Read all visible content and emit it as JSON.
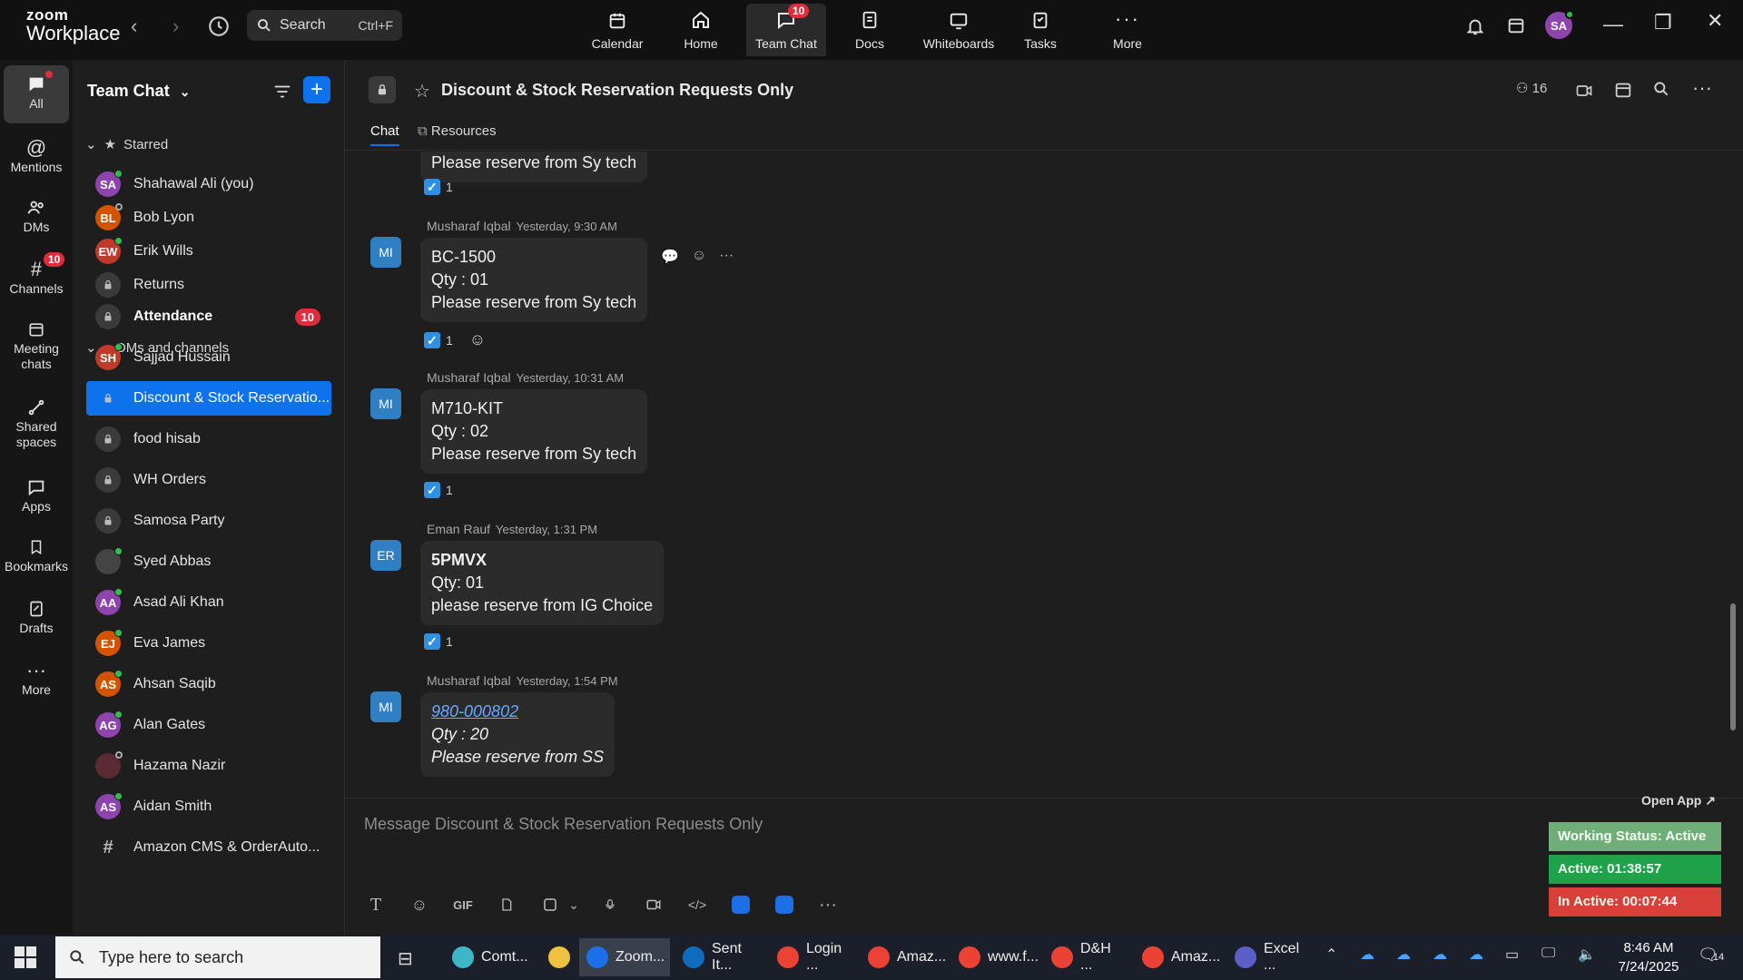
{
  "app": {
    "logo_line1": "zoom",
    "logo_line2": "Workplace",
    "search_label": "Search",
    "search_shortcut": "Ctrl+F"
  },
  "topnav": [
    {
      "label": "Calendar",
      "icon": "calendar-icon"
    },
    {
      "label": "Home",
      "icon": "home-icon"
    },
    {
      "label": "Team Chat",
      "icon": "chat-icon",
      "badge": "10",
      "active": true
    },
    {
      "label": "Docs",
      "icon": "docs-icon"
    },
    {
      "label": "Whiteboards",
      "icon": "whiteboard-icon"
    },
    {
      "label": "Tasks",
      "icon": "tasks-icon"
    },
    {
      "label": "More",
      "icon": "more-icon"
    }
  ],
  "user_initials": "SA",
  "rail": [
    {
      "label": "All",
      "icon": "chat-bubble-icon"
    },
    {
      "label": "Mentions",
      "icon": "at-icon"
    },
    {
      "label": "DMs",
      "icon": "people-icon"
    },
    {
      "label": "Channels",
      "icon": "hash-icon",
      "badge": "10"
    },
    {
      "label": "Meeting",
      "label2": "chats",
      "icon": "calendar-icon"
    },
    {
      "label": "Shared",
      "label2": "spaces",
      "icon": "share-icon"
    },
    {
      "label": "Apps",
      "icon": "apps-icon"
    },
    {
      "label": "Bookmarks",
      "icon": "bookmark-icon"
    },
    {
      "label": "Drafts",
      "icon": "drafts-icon"
    },
    {
      "label": "More",
      "icon": "more-icon"
    }
  ],
  "sidebar": {
    "title": "Team Chat",
    "starred_label": "Starred",
    "dms_label": "DMs and channels",
    "starred": [
      {
        "name": "Shahawal Ali (you)",
        "initials": "SA",
        "color": "#8e44ad",
        "status": "online"
      },
      {
        "name": "Bob Lyon",
        "initials": "BL",
        "color": "#d35400",
        "status": "away"
      },
      {
        "name": "Erik Wills",
        "initials": "EW",
        "color": "#c0392b",
        "status": "online"
      },
      {
        "name": "Returns",
        "type": "channel"
      }
    ],
    "items": [
      {
        "name": "Attendance",
        "type": "channel",
        "bold": true,
        "badge": "10"
      },
      {
        "name": "Sajjad Hussain",
        "initials": "SH",
        "color": "#c0392b",
        "status": "online"
      },
      {
        "name": "Discount & Stock Reservatio...",
        "type": "channel",
        "selected": true
      },
      {
        "name": "food hisab",
        "type": "channel"
      },
      {
        "name": "WH Orders",
        "type": "channel"
      },
      {
        "name": "Samosa Party",
        "type": "channel"
      },
      {
        "name": "Syed Abbas",
        "initials": "",
        "color": "#444444",
        "status": "online"
      },
      {
        "name": "Asad Ali Khan",
        "initials": "AA",
        "color": "#8e44ad",
        "status": "online"
      },
      {
        "name": "Eva James",
        "initials": "EJ",
        "color": "#d35400",
        "status": "online"
      },
      {
        "name": "Ahsan Saqib",
        "initials": "AS",
        "color": "#d35400",
        "status": "online"
      },
      {
        "name": "Alan Gates",
        "initials": "AG",
        "color": "#8e44ad",
        "status": "online"
      },
      {
        "name": "Hazama Nazir",
        "initials": "",
        "color": "#5a2a35",
        "status": "away"
      },
      {
        "name": "Aidan Smith",
        "initials": "AS",
        "color": "#8e44ad",
        "status": "online"
      },
      {
        "name": "Amazon CMS & OrderAuto...",
        "type": "hash"
      }
    ]
  },
  "channel": {
    "title": "Discount & Stock Reservation Requests Only",
    "members": "16",
    "tabs": [
      "Chat",
      "Resources"
    ]
  },
  "messages": {
    "partial_line": "Please reserve from Sy tech",
    "partial_reaction": "1",
    "list": [
      {
        "author": "Musharaf Iqbal",
        "time": "Yesterday, 9:30 AM",
        "initials": "MI",
        "lines": [
          "BC-1500",
          "Qty : 01",
          "Please reserve from Sy tech"
        ],
        "reaction": "1"
      },
      {
        "author": "Musharaf Iqbal",
        "time": "Yesterday, 10:31 AM",
        "initials": "MI",
        "lines": [
          "M710-KIT",
          "Qty : 02",
          "Please reserve from Sy tech"
        ],
        "reaction": "1"
      },
      {
        "author": "Eman Rauf",
        "time": "Yesterday, 1:31 PM",
        "initials": "ER",
        "lines": [
          "5PMVX",
          "Qty: 01",
          "please reserve from IG Choice"
        ],
        "reaction": "1"
      },
      {
        "author": "Musharaf Iqbal",
        "time": "Yesterday, 1:54 PM",
        "initials": "MI",
        "lines": [
          "980-000802",
          "Qty : 20",
          "Please reserve from SS"
        ]
      }
    ]
  },
  "composer": {
    "placeholder": "Message Discount & Stock Reservation Requests Only",
    "gif_label": "GIF"
  },
  "work_status": {
    "open_app": "Open App ↗",
    "status": "Working Status: Active",
    "active": "Active: 01:38:57",
    "inactive": "In Active: 00:07:44"
  },
  "taskbar": {
    "search_placeholder": "Type here to search",
    "apps": [
      {
        "label": "Comt...",
        "color": "#3fb6c8"
      },
      {
        "label": "",
        "color": "#f0c040"
      },
      {
        "label": "Zoom...",
        "color": "#1d6fe8"
      },
      {
        "label": "Sent It...",
        "color": "#0f6cbd"
      },
      {
        "label": "Login ...",
        "color": "#ea4335"
      },
      {
        "label": "Amaz...",
        "color": "#ea4335"
      },
      {
        "label": "www.f...",
        "color": "#ea4335"
      },
      {
        "label": "D&H ...",
        "color": "#ea4335"
      },
      {
        "label": "Amaz...",
        "color": "#ea4335"
      },
      {
        "label": "Excel ...",
        "color": "#5b5fc7"
      }
    ],
    "time": "8:46 AM",
    "date": "7/24/2025",
    "notif_count": "14"
  }
}
